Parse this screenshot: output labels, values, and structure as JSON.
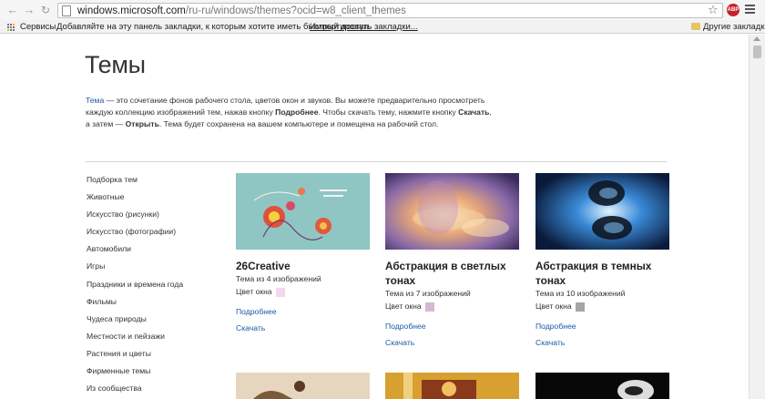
{
  "browser": {
    "url_host": "windows.microsoft.com",
    "url_path": "/ru-ru/windows/themes?ocid=w8_client_themes",
    "abp_label": "ABP",
    "bookmarks": {
      "services": "Сервисы",
      "hint": "Добавляйте на эту панель закладки, к которым хотите иметь быстрый доступ.",
      "import": "Импортировать закладки...",
      "other": "Другие закладки"
    }
  },
  "page": {
    "title": "Темы",
    "intro": {
      "link": "Тема",
      "p1": " — это сочетание фонов рабочего стола, цветов окон и звуков. Вы можете предварительно просмотреть каждую коллекцию изображений тем, нажав кнопку ",
      "b1": "Подробнее",
      "p2": ". Чтобы скачать тему, нажмите кнопку ",
      "b2": "Скачать",
      "p3": ", а затем — ",
      "b3": "Открыть",
      "p4": ". Тема будет сохранена на вашем компьютере и помещена на рабочий стол."
    },
    "categories": [
      "Подборка тем",
      "Животные",
      "Искусство (рисунки)",
      "Искусство (фотографии)",
      "Автомобили",
      "Игры",
      "Праздники и времена года",
      "Фильмы",
      "Чудеса природы",
      "Местности и пейзажи",
      "Растения и цветы",
      "Фирменные темы",
      "Из сообщества"
    ],
    "window_color_label": "Цвет окна",
    "more_label": "Подробнее",
    "download_label": "Скачать",
    "themes": [
      {
        "title": "26Creative",
        "sub": "Тема из 4 изображений",
        "swatch": "#f4d6ee"
      },
      {
        "title": "Абстракция в светлых тонах",
        "sub": "Тема из 7 изображений",
        "swatch": "#d6b9d3"
      },
      {
        "title": "Абстракция в темных тонах",
        "sub": "Тема из 10 изображений",
        "swatch": "#a6a6a6"
      }
    ]
  },
  "colors": {
    "link": "#1a5aa6",
    "abp_red": "#c7202d"
  }
}
